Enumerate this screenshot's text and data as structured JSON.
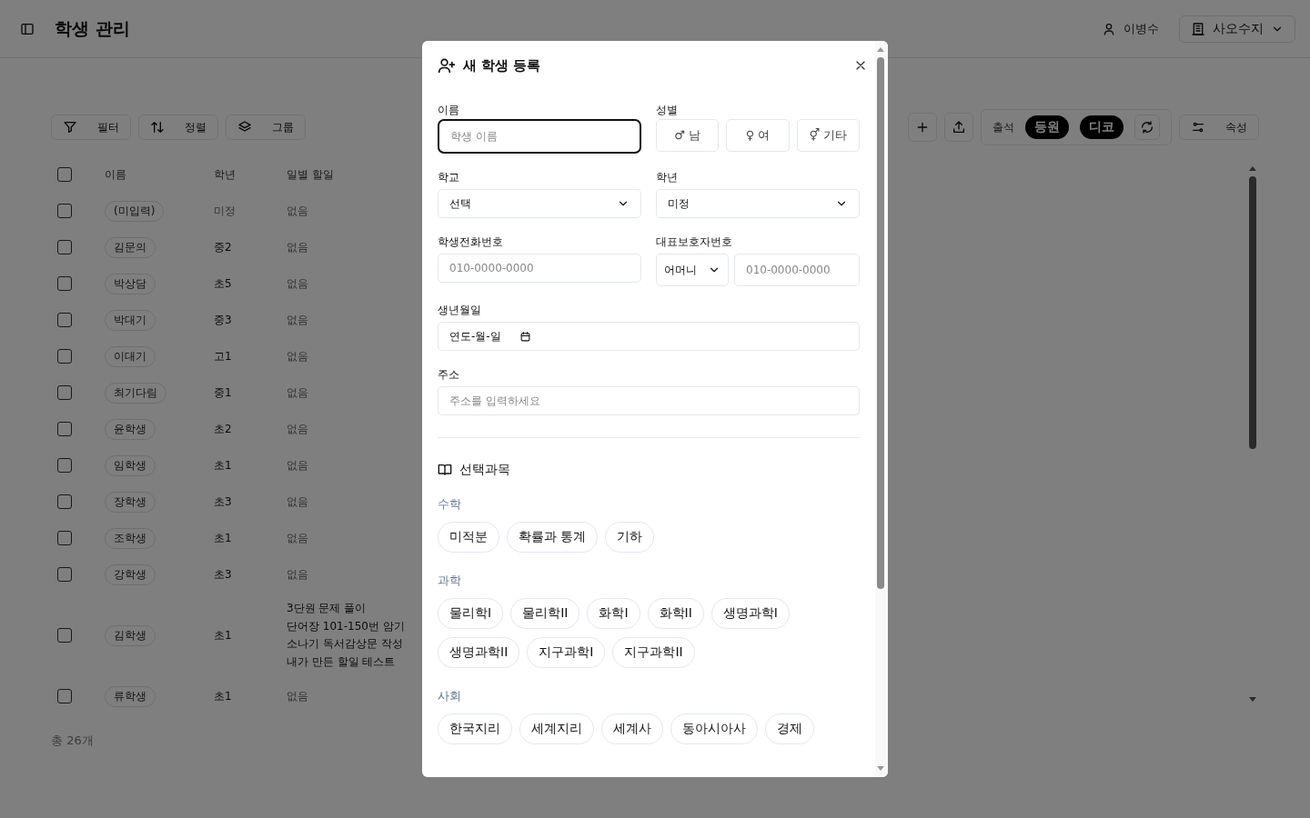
{
  "header": {
    "title": "학생 관리",
    "user": "이병수",
    "org": "사오수지"
  },
  "toolbar": {
    "buttons": [
      {
        "kind": "filter",
        "label": "필터"
      },
      {
        "kind": "sort",
        "label": "정렬"
      },
      {
        "kind": "group",
        "label": "그룹"
      }
    ],
    "attendance_label": "출석",
    "attendance_chips": [
      "등원",
      "디코"
    ],
    "properties": "속성"
  },
  "table": {
    "select_all_checked": false,
    "columns": [
      "이름",
      "학년",
      "일별 할일"
    ],
    "rows": [
      {
        "checked": false,
        "name": "(미입력)",
        "grade": "미정",
        "grade_muted": true,
        "todos": [
          "없음"
        ],
        "todos_muted": true
      },
      {
        "checked": false,
        "name": "김문의",
        "grade": "중2",
        "grade_muted": false,
        "todos": [
          "없음"
        ],
        "todos_muted": true
      },
      {
        "checked": false,
        "name": "박상담",
        "grade": "초5",
        "grade_muted": false,
        "todos": [
          "없음"
        ],
        "todos_muted": true
      },
      {
        "checked": false,
        "name": "박대기",
        "grade": "중3",
        "grade_muted": false,
        "todos": [
          "없음"
        ],
        "todos_muted": true
      },
      {
        "checked": false,
        "name": "이대기",
        "grade": "고1",
        "grade_muted": false,
        "todos": [
          "없음"
        ],
        "todos_muted": true
      },
      {
        "checked": false,
        "name": "최기다림",
        "grade": "중1",
        "grade_muted": false,
        "todos": [
          "없음"
        ],
        "todos_muted": true
      },
      {
        "checked": false,
        "name": "윤학생",
        "grade": "초2",
        "grade_muted": false,
        "todos": [
          "없음"
        ],
        "todos_muted": true
      },
      {
        "checked": false,
        "name": "임학생",
        "grade": "초1",
        "grade_muted": false,
        "todos": [
          "없음"
        ],
        "todos_muted": true
      },
      {
        "checked": false,
        "name": "장학생",
        "grade": "초3",
        "grade_muted": false,
        "todos": [
          "없음"
        ],
        "todos_muted": true
      },
      {
        "checked": false,
        "name": "조학생",
        "grade": "초1",
        "grade_muted": false,
        "todos": [
          "없음"
        ],
        "todos_muted": true
      },
      {
        "checked": false,
        "name": "강학생",
        "grade": "초3",
        "grade_muted": false,
        "todos": [
          "없음"
        ],
        "todos_muted": true
      },
      {
        "checked": false,
        "name": "김학생",
        "grade": "초1",
        "grade_muted": false,
        "todos": [
          "3단원 문제 풀이",
          "단어장 101-150번 암기",
          "소나기 독서감상문 작성",
          "내가 만든 할일 테스트"
        ],
        "todos_muted": false
      },
      {
        "checked": false,
        "name": "류학생",
        "grade": "초1",
        "grade_muted": false,
        "todos": [
          "없음"
        ],
        "todos_muted": true
      }
    ],
    "footer": "총 26개"
  },
  "dialog": {
    "title": "새 학생 등록",
    "name": {
      "label": "이름",
      "placeholder": "학생 이름",
      "focused": true
    },
    "gender": {
      "label": "성별",
      "options": [
        {
          "label": "♂ 남",
          "selected": false
        },
        {
          "label": "♀ 여",
          "selected": false
        },
        {
          "label": "⚥ 기타",
          "selected": false
        }
      ]
    },
    "school": {
      "label": "학교",
      "value": "선택"
    },
    "grade": {
      "label": "학년",
      "value": "미정"
    },
    "student_phone": {
      "label": "학생전화번호",
      "placeholder": "010-0000-0000"
    },
    "guardian_phone": {
      "label": "대표보호자번호",
      "relation": "어머니",
      "placeholder": "010-0000-0000"
    },
    "birthdate": {
      "label": "생년월일",
      "value": "연도-월-일"
    },
    "address": {
      "label": "주소",
      "placeholder": "주소를 입력하세요"
    },
    "subjects": {
      "title": "선택과목",
      "groups": [
        {
          "name": "수학",
          "items": [
            {
              "label": "미적분",
              "selected": false
            },
            {
              "label": "확률과 통계",
              "selected": false
            },
            {
              "label": "기하",
              "selected": false
            }
          ]
        },
        {
          "name": "과학",
          "items": [
            {
              "label": "물리학I",
              "selected": false
            },
            {
              "label": "물리학II",
              "selected": false
            },
            {
              "label": "화학I",
              "selected": false
            },
            {
              "label": "화학II",
              "selected": false
            },
            {
              "label": "생명과학I",
              "selected": false
            },
            {
              "label": "생명과학II",
              "selected": false
            },
            {
              "label": "지구과학I",
              "selected": false
            },
            {
              "label": "지구과학II",
              "selected": false
            }
          ]
        },
        {
          "name": "사회",
          "items": [
            {
              "label": "한국지리",
              "selected": false
            },
            {
              "label": "세계지리",
              "selected": false
            },
            {
              "label": "세계사",
              "selected": false
            },
            {
              "label": "동아시아사",
              "selected": false
            },
            {
              "label": "경제",
              "selected": false
            }
          ]
        }
      ]
    }
  }
}
